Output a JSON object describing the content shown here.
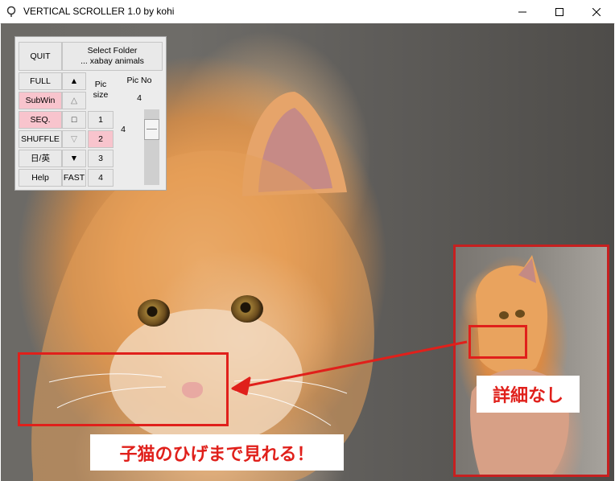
{
  "window": {
    "title": "VERTICAL SCROLLER 1.0 by kohi"
  },
  "panel": {
    "quit": "QUIT",
    "select_folder": "Select Folder",
    "folder_name": "... xabay animals",
    "full": "FULL",
    "subwin": "SubWin",
    "seq": "SEQ.",
    "shuffle": "SHUFFLE",
    "lang": "日/英",
    "help": "Help",
    "fast": "FAST",
    "pic_size_label": "Pic\nsize",
    "pic_no_label": "Pic No",
    "pic_no_value": "4",
    "slider_value": "4",
    "size_1": "1",
    "size_2": "2",
    "size_3": "3",
    "size_4": "4",
    "up_filled": "▲",
    "up_outline": "△",
    "square": "□",
    "down_outline": "▽",
    "down_filled": "▼"
  },
  "annotations": {
    "main_caption": "子猫のひげまで見れる！",
    "inset_caption": "詳細なし"
  },
  "colors": {
    "pink_button": "#f8c4cd",
    "annotation_red": "#e0201b"
  }
}
